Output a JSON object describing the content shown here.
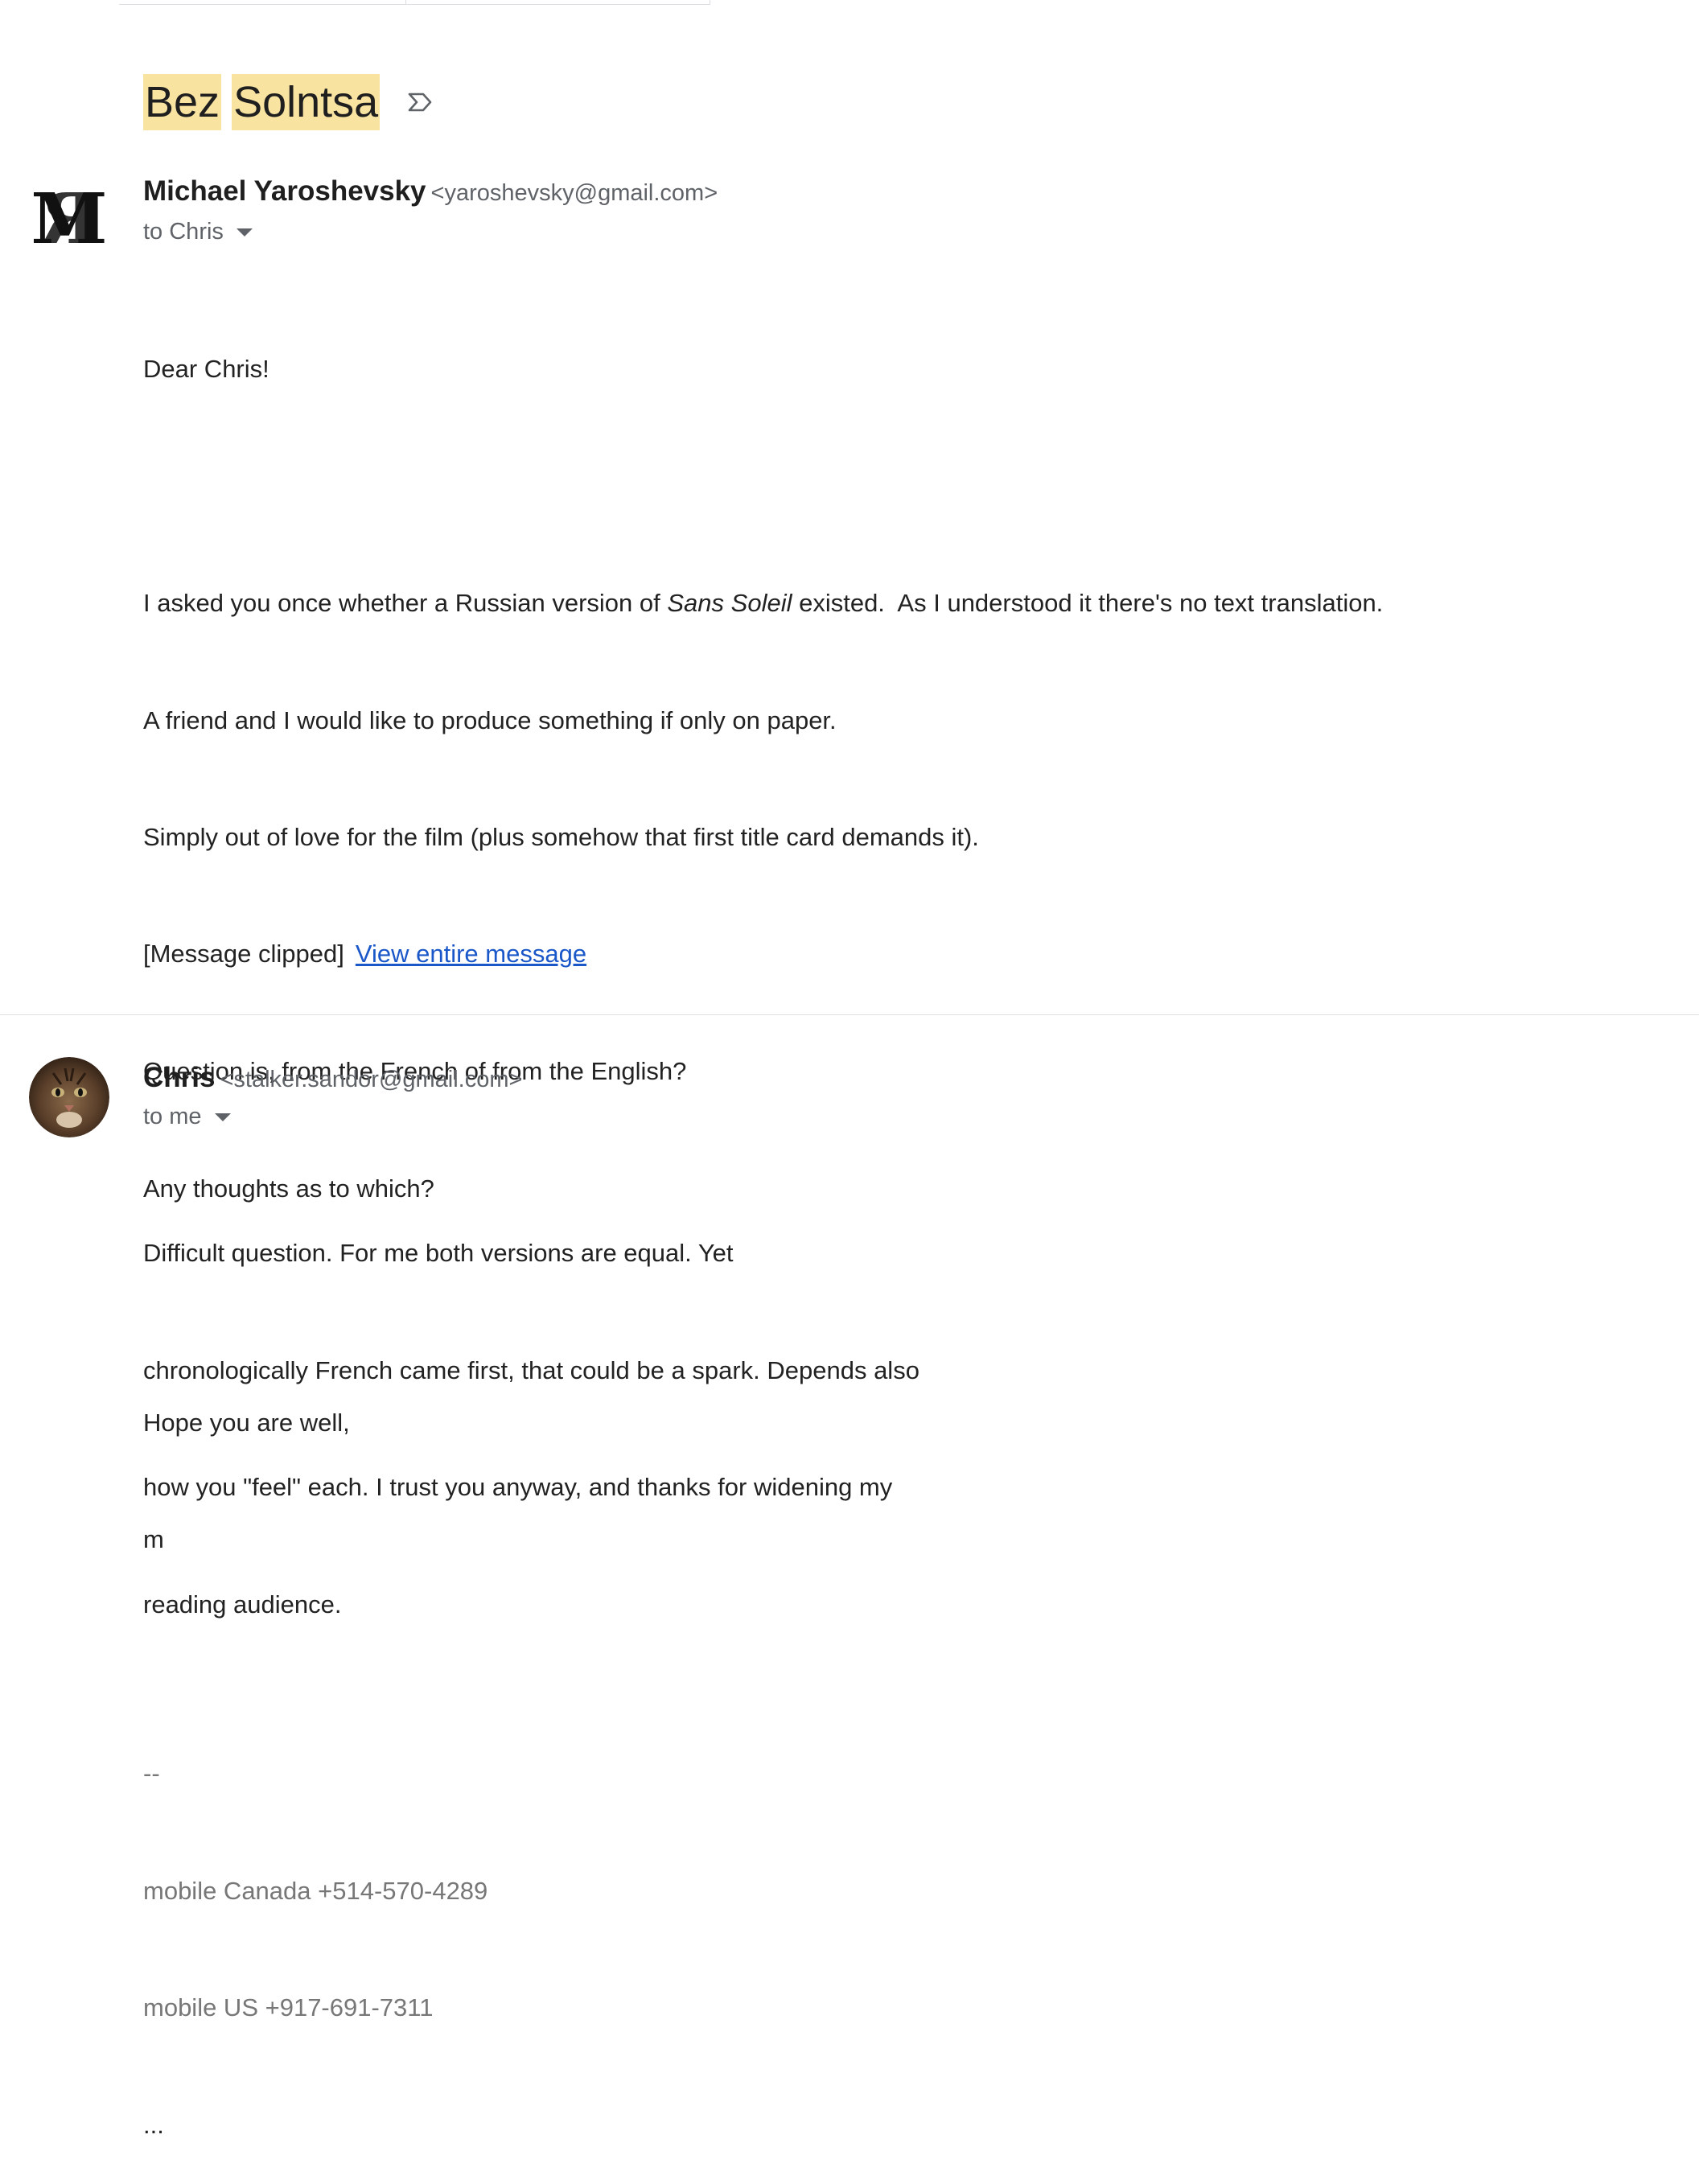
{
  "subject": {
    "word1": "Bez",
    "word2": "Solntsa"
  },
  "messages": [
    {
      "sender_name": "Michael Yaroshevsky",
      "sender_email": "<yaroshevsky@gmail.com>",
      "recipient": "to Chris",
      "avatar_text": "MY",
      "lines": {
        "l1": "Dear Chris!",
        "l2a": "I asked you once whether a Russian version of ",
        "l2b": "Sans Soleil",
        "l2c": " existed.  As I understood it there's no text translation.",
        "l3": "A friend and I would like to produce something if only on paper.",
        "l4": "Simply out of love for the film (plus somehow that first title card demands it).",
        "l5": "Question is, from the French of from the English?",
        "l6": "Any thoughts as to which?",
        "l7": "Hope you are well,",
        "l8": "m"
      },
      "signature": {
        "sep": "--",
        "phone1": "mobile Canada +514-570-4289",
        "phone2": "mobile US +917-691-7311",
        "ellipsis": "..."
      },
      "clipped_text": "[Message clipped]",
      "view_entire_link": "View entire message"
    },
    {
      "sender_name": "Chris",
      "sender_email": "<stalker.sandor@gmail.com>",
      "recipient": "to me",
      "lines": {
        "l1": "Difficult question. For me both versions are equal. Yet",
        "l2": "chronologically French came first, that could be a spark. Depends also",
        "l3": "how you \"feel\" each. I trust you anyway, and thanks for widening my",
        "l4": "reading audience."
      }
    }
  ],
  "colors": {
    "highlight": "#f8e3a1",
    "link": "#1a57c8",
    "muted": "#5f6368",
    "signature": "#777777"
  }
}
